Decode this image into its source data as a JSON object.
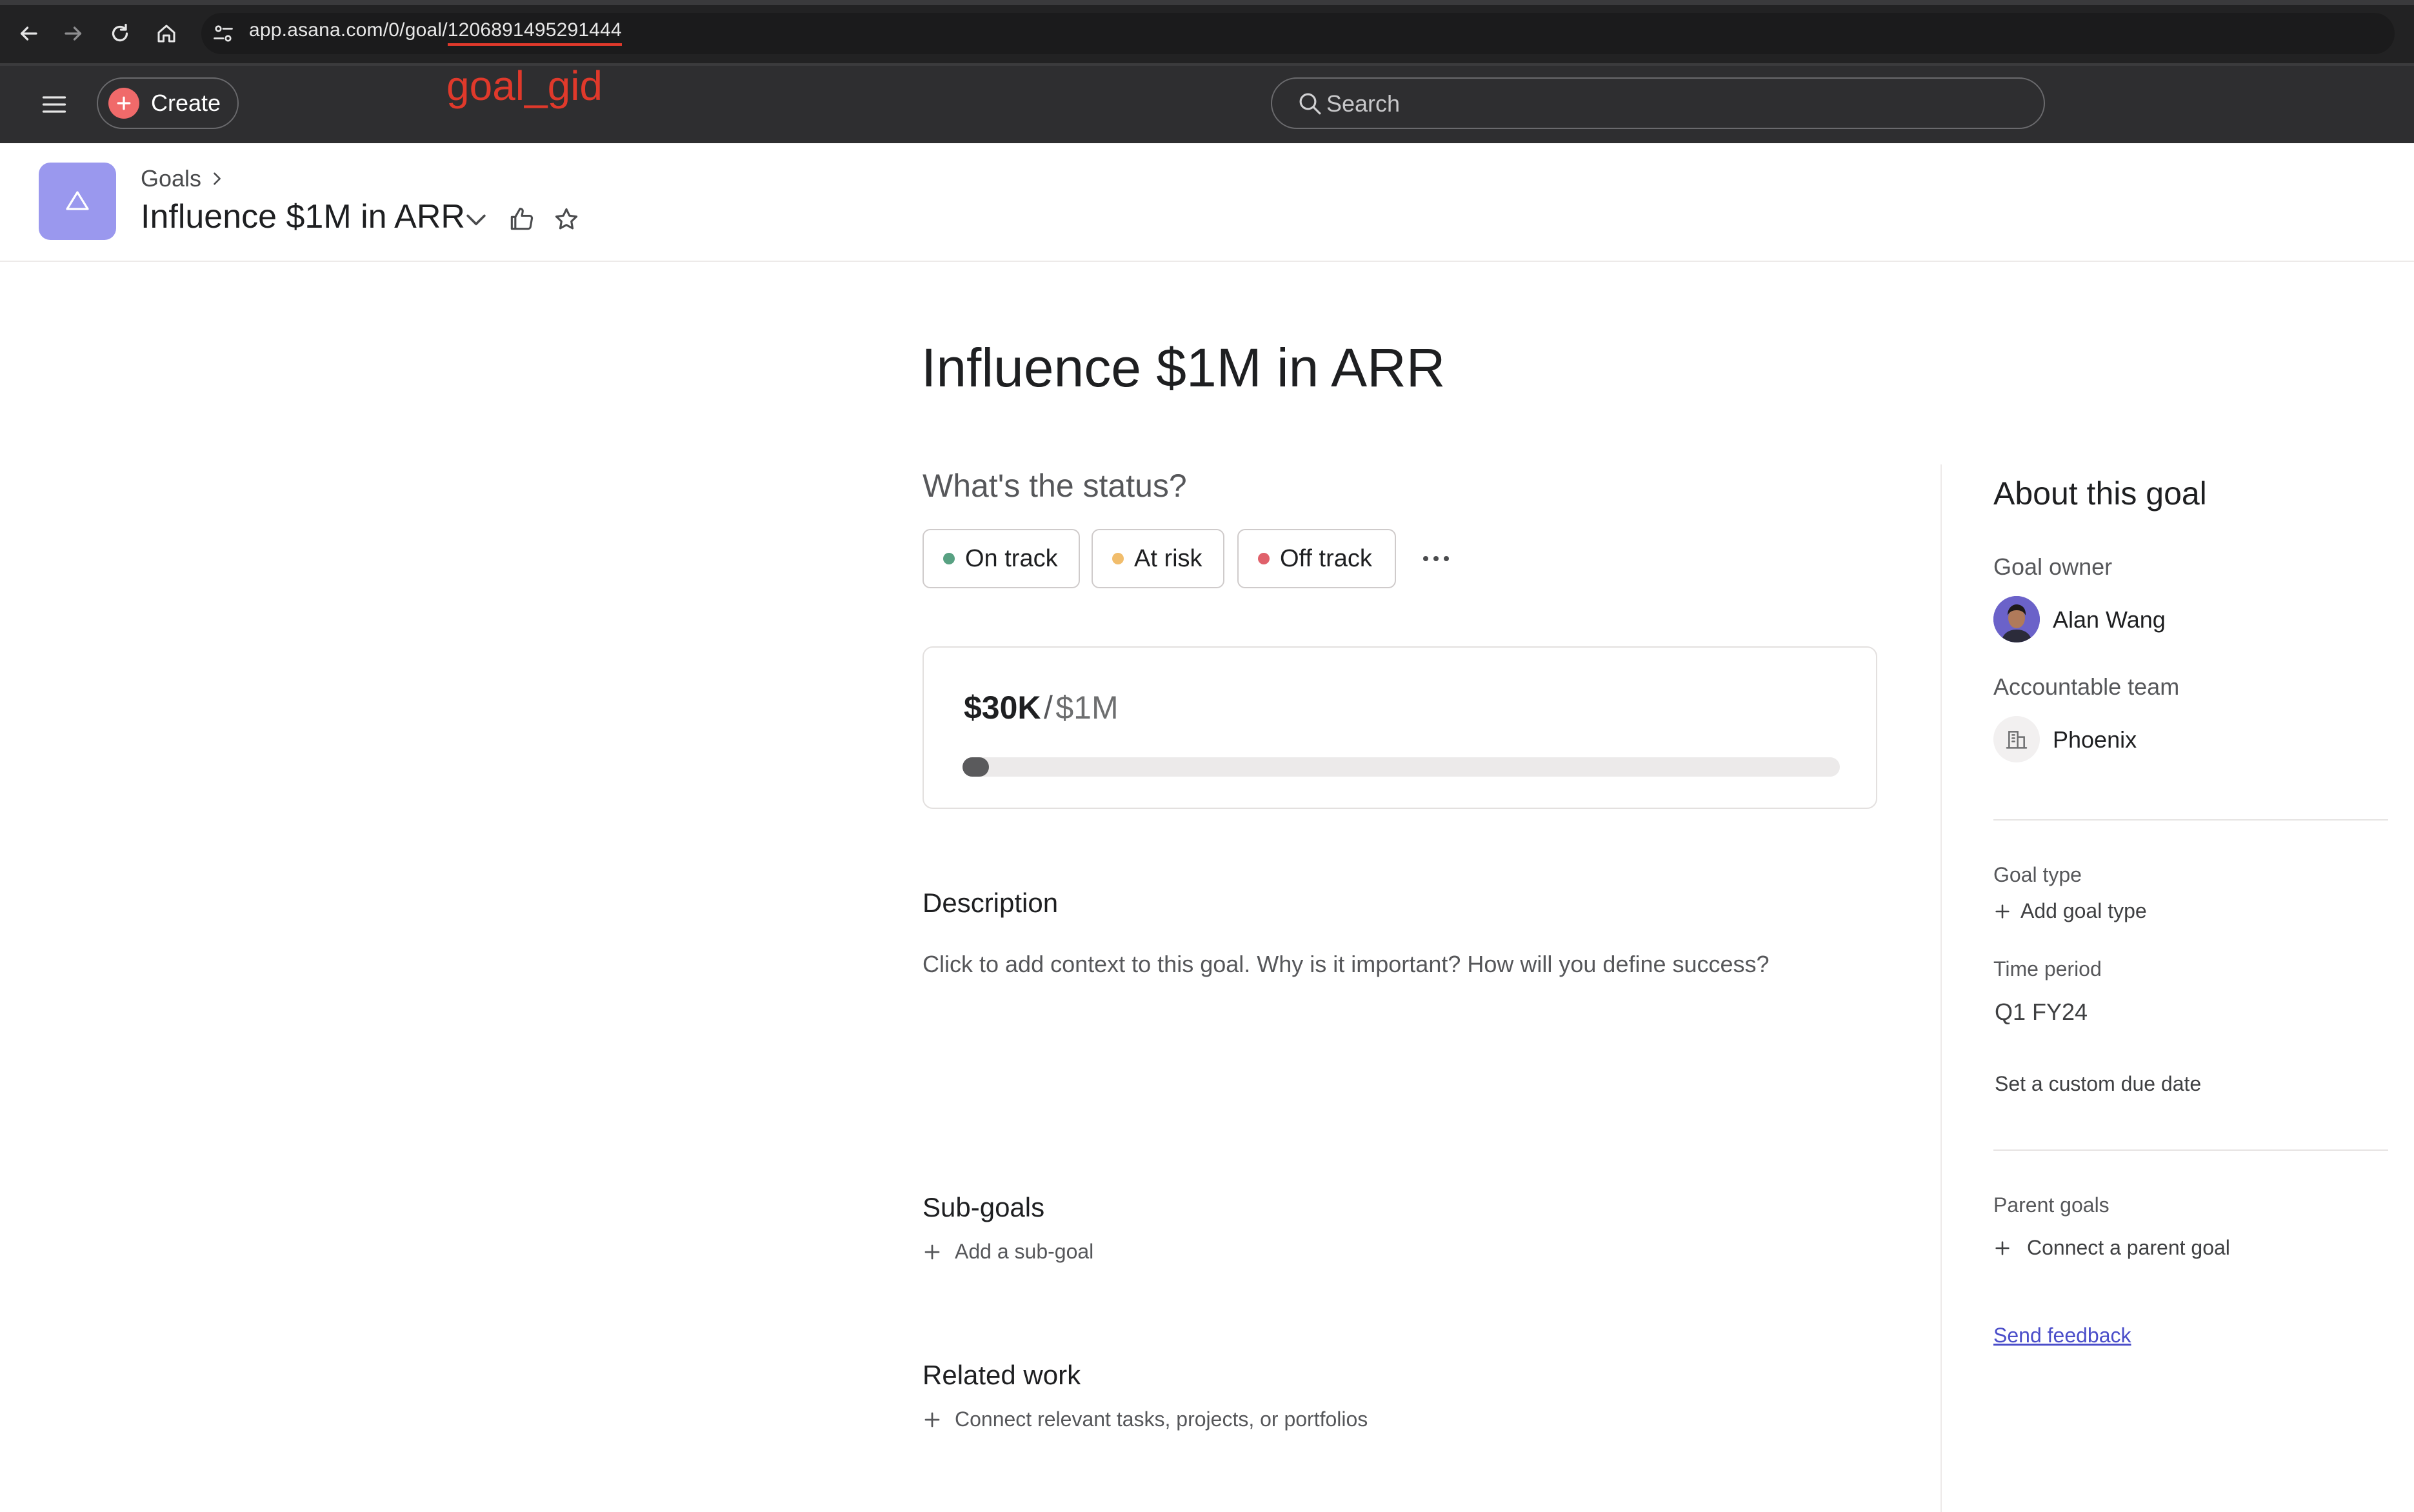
{
  "browser": {
    "url_prefix": "app.asana.com/0/goal/",
    "url_gid": "1206891495291444",
    "annotation": "goal_gid"
  },
  "topbar": {
    "create_label": "Create",
    "search_placeholder": "Search"
  },
  "header": {
    "breadcrumb": "Goals",
    "title": "Influence $1M in ARR"
  },
  "main": {
    "title": "Influence $1M in ARR",
    "status_prompt": "What's the status?",
    "status_options": [
      {
        "label": "On track",
        "color": "#58a182"
      },
      {
        "label": "At risk",
        "color": "#f1bd6c"
      },
      {
        "label": "Off track",
        "color": "#e0616b"
      }
    ],
    "progress": {
      "current": "$30K",
      "separator": "/",
      "target": "$1M",
      "fraction": 0.03
    },
    "description_heading": "Description",
    "description_placeholder": "Click to add context to this goal. Why is it important? How will you define success?",
    "subgoals_heading": "Sub-goals",
    "add_subgoal": "Add a sub-goal",
    "related_heading": "Related work",
    "related_add": "Connect relevant tasks, projects, or portfolios"
  },
  "about": {
    "title": "About this goal",
    "owner_label": "Goal owner",
    "owner_name": "Alan Wang",
    "team_label": "Accountable team",
    "team_name": "Phoenix",
    "goal_type_label": "Goal type",
    "add_goal_type": "Add goal type",
    "time_period_label": "Time period",
    "time_period_value": "Q1 FY24",
    "custom_due_date": "Set a custom due date",
    "parent_goals_label": "Parent goals",
    "connect_parent": "Connect a parent goal",
    "send_feedback": "Send feedback"
  },
  "colors": {
    "brand_coral": "#f06a6a",
    "goal_icon_bg": "#9a98ee",
    "annotation_red": "#e0392b",
    "link": "#4a4dc9"
  }
}
